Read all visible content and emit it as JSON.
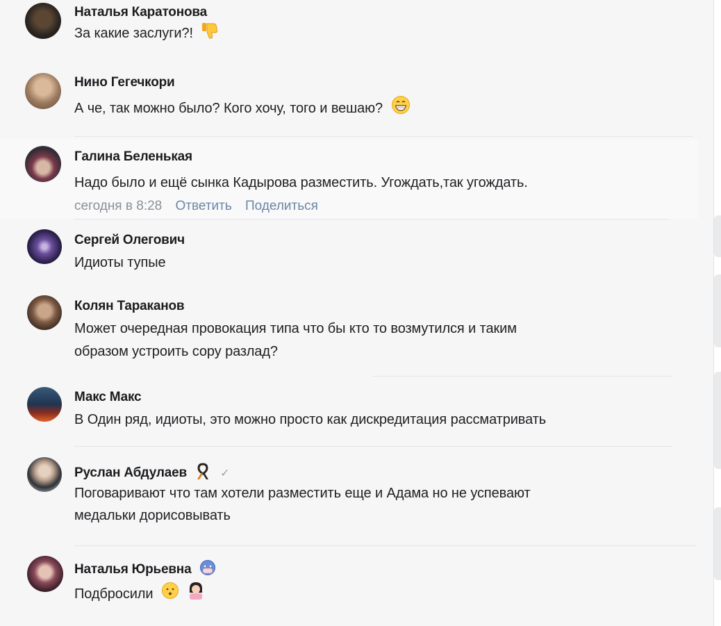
{
  "comments": [
    {
      "author": "Наталья Каратонова",
      "lines": [
        "За какие заслуги?!"
      ],
      "emoji": "thumbs-down-icon"
    },
    {
      "author": "Нино Гегечкори",
      "lines": [
        "А че, так можно было? Кого хочу, того и вешаю?"
      ],
      "emoji": "grinning-face-icon"
    },
    {
      "author": "Галина Беленькая",
      "lines": [
        "Надо было и ещё сынка Кадырова разместить. Угождать,так угождать."
      ],
      "meta": {
        "time": "сегодня в 8:28",
        "reply": "Ответить",
        "share": "Поделиться"
      }
    },
    {
      "author": "Сергей Олегович",
      "lines": [
        "Идиоты тупые"
      ]
    },
    {
      "author": "Колян Тараканов",
      "lines": [
        "Может очередная провокация типа что бы кто то возмутился и таким",
        "образом устроить сору разлад?"
      ]
    },
    {
      "author": "Макс Макс",
      "lines": [
        "В Один ряд, идиоты, это можно просто как дискредитация рассматривать"
      ]
    },
    {
      "author": "Руслан Абдулаев",
      "lines": [
        "Поговаривают что там хотели разместить еще и Адама но не успевают",
        "медальки дорисовывать"
      ],
      "badge": "st-george-ribbon-icon"
    },
    {
      "author": "Наталья Юрьевна",
      "lines": [
        "Подбросили"
      ],
      "badge": "masked-face-icon"
    }
  ],
  "colors": {
    "background": "#f6f6f7",
    "link": "#6b86a6",
    "meta": "#8a9099",
    "divider": "#e4e5e8"
  }
}
